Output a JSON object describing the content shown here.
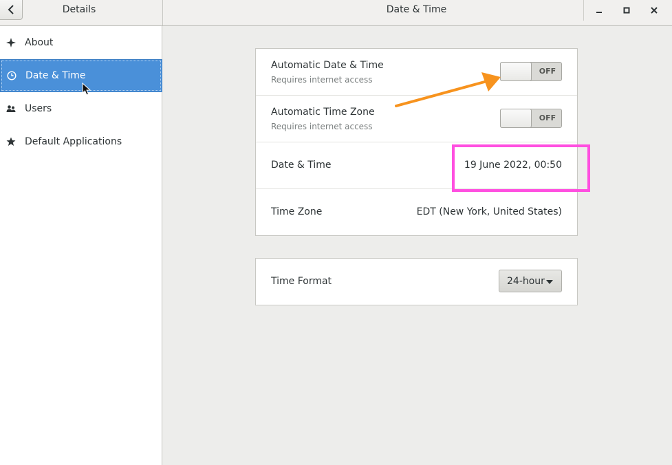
{
  "header": {
    "sidebar_title": "Details",
    "main_title": "Date & Time"
  },
  "sidebar": {
    "items": [
      {
        "label": "About",
        "icon": "sparkle-icon"
      },
      {
        "label": "Date & Time",
        "icon": "clock-icon",
        "selected": true
      },
      {
        "label": "Users",
        "icon": "users-icon"
      },
      {
        "label": "Default Applications",
        "icon": "star-icon"
      }
    ]
  },
  "settings": {
    "auto_datetime": {
      "title": "Automatic Date & Time",
      "subtitle": "Requires internet access",
      "state": "OFF"
    },
    "auto_timezone": {
      "title": "Automatic Time Zone",
      "subtitle": "Requires internet access",
      "state": "OFF"
    },
    "datetime": {
      "title": "Date & Time",
      "value": "19 June 2022, 00:50"
    },
    "timezone": {
      "title": "Time Zone",
      "value": "EDT (New York, United States)"
    },
    "time_format": {
      "title": "Time Format",
      "value": "24-hour"
    }
  },
  "colors": {
    "selection": "#4a90d9",
    "highlight_box": "#ff4fe0",
    "annotation_arrow": "#f7931e"
  }
}
